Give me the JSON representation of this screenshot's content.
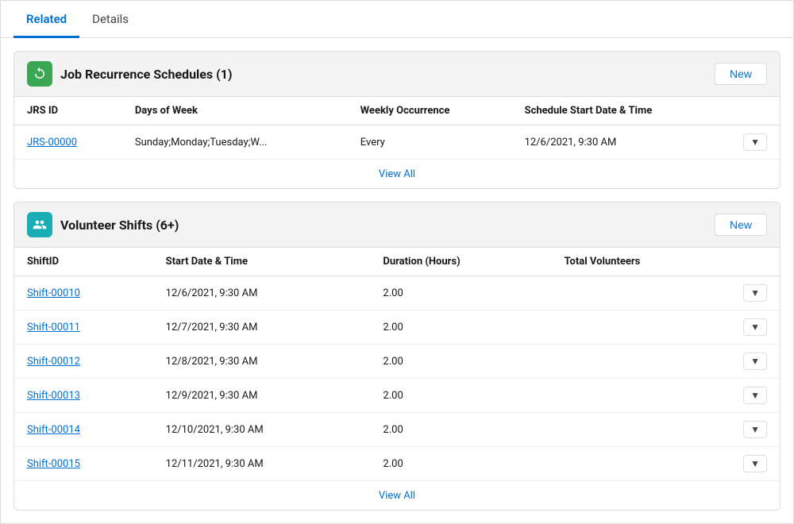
{
  "tabs": [
    {
      "id": "related",
      "label": "Related",
      "active": true
    },
    {
      "id": "details",
      "label": "Details",
      "active": false
    }
  ],
  "sections": [
    {
      "id": "jrs",
      "icon_type": "green",
      "icon_name": "recurrence-icon",
      "title": "Job Recurrence Schedules (1)",
      "new_button": "New",
      "columns": [
        "JRS ID",
        "Days of Week",
        "Weekly Occurrence",
        "Schedule Start Date & Time"
      ],
      "rows": [
        {
          "id": "JRS-00000",
          "days_of_week": "Sunday;Monday;Tuesday;W...",
          "weekly_occurrence": "Every",
          "schedule_start": "12/6/2021, 9:30 AM",
          "has_dropdown": true
        }
      ],
      "view_all": "View All"
    },
    {
      "id": "vs",
      "icon_type": "teal",
      "icon_name": "volunteer-shifts-icon",
      "title": "Volunteer Shifts (6+)",
      "new_button": "New",
      "columns": [
        "ShiftID",
        "Start Date & Time",
        "Duration (Hours)",
        "Total Volunteers"
      ],
      "rows": [
        {
          "id": "Shift-00010",
          "start": "12/6/2021, 9:30 AM",
          "duration": "2.00",
          "volunteers": "",
          "has_dropdown": true
        },
        {
          "id": "Shift-00011",
          "start": "12/7/2021, 9:30 AM",
          "duration": "2.00",
          "volunteers": "",
          "has_dropdown": true
        },
        {
          "id": "Shift-00012",
          "start": "12/8/2021, 9:30 AM",
          "duration": "2.00",
          "volunteers": "",
          "has_dropdown": true
        },
        {
          "id": "Shift-00013",
          "start": "12/9/2021, 9:30 AM",
          "duration": "2.00",
          "volunteers": "",
          "has_dropdown": true
        },
        {
          "id": "Shift-00014",
          "start": "12/10/2021, 9:30 AM",
          "duration": "2.00",
          "volunteers": "",
          "has_dropdown": true
        },
        {
          "id": "Shift-00015",
          "start": "12/11/2021, 9:30 AM",
          "duration": "2.00",
          "volunteers": "",
          "has_dropdown": true
        }
      ],
      "view_all": "View All"
    }
  ]
}
